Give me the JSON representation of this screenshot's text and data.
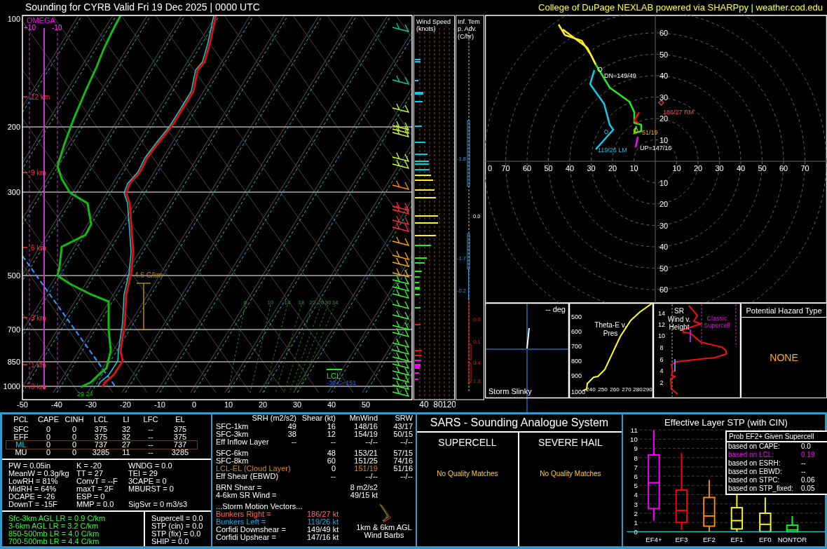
{
  "header": {
    "title": "Sounding for CYRB Valid  Fri 19 Dec 2025 | 0000 UTC",
    "credit": "College of DuPage NEXLAB powered via SHARPpy | weather.cod.edu"
  },
  "skewt": {
    "pressure_labels": [
      "100",
      "200",
      "300",
      "500",
      "700",
      "850",
      "1000"
    ],
    "temperature_labels": [
      "-50",
      "-40",
      "-30",
      "-20",
      "-10",
      "0",
      "10",
      "20",
      "30",
      "40",
      "50"
    ],
    "height_labels": [
      "12 km",
      "9 km",
      "6 km",
      "3 km",
      "1 km",
      "0 km"
    ],
    "omega": {
      "title": "OMEGA",
      "ticks": [
        "+10",
        "-10"
      ]
    },
    "lapse_rate": "4.6 C/km",
    "lcl": "LCL",
    "isotherm_height": "-30 C=151",
    "surface_values": "29 24",
    "mixing_ratio_labels": [
      "6",
      "10",
      "14",
      "18",
      "22",
      "26",
      "30",
      "34"
    ]
  },
  "wind_speed": {
    "title": "Wind Speed (knots)",
    "ticks": [
      "40",
      "80",
      "120"
    ]
  },
  "temp_advection": {
    "title": "Inf. Temp. Adv. (C/hr)",
    "values": [
      {
        "text": "-1.8",
        "kind": "cold"
      },
      {
        "text": "0.0",
        "kind": "neutral"
      },
      {
        "text": "-1.7",
        "kind": "cold"
      },
      {
        "text": "-0.2",
        "kind": "cold"
      },
      {
        "text": "0.0",
        "kind": "warm"
      },
      {
        "text": "0.1",
        "kind": "warm"
      },
      {
        "text": "0.4",
        "kind": "warm"
      },
      {
        "text": "1.3",
        "kind": "warm"
      }
    ]
  },
  "hodograph": {
    "x_labels": [
      "0",
      "70",
      "60",
      "50",
      "40",
      "30",
      "20",
      "10",
      "10",
      "20",
      "30",
      "40",
      "50",
      "60",
      "70"
    ],
    "y_labels": [
      "60",
      "50",
      "40",
      "30",
      "20",
      "10",
      "10",
      "20",
      "30",
      "40",
      "50",
      "60"
    ],
    "annotations": [
      {
        "text": "DN=149/49",
        "kind": "downshear"
      },
      {
        "text": "186/27 RM",
        "kind": "right_mover"
      },
      {
        "text": "51/19",
        "kind": "mean_wind"
      },
      {
        "text": "UP=147/16",
        "kind": "upshear"
      },
      {
        "text": "119/26 LM",
        "kind": "left_mover"
      }
    ]
  },
  "storm_slinky": {
    "direction": "-- deg",
    "label": "Storm Slinky"
  },
  "theta_e": {
    "title": "Theta-E v. Pres",
    "y_ticks": [
      "500",
      "600",
      "700",
      "800",
      "900",
      "1000"
    ],
    "x_ticks": [
      "240",
      "250",
      "260",
      "270",
      "280",
      "290"
    ]
  },
  "sr_wind": {
    "title": "SR Wind v. Height",
    "y_ticks": [
      "14",
      "12",
      "10",
      "8",
      "6",
      "4",
      "2"
    ],
    "zone": "Classic Supercell"
  },
  "hazard": {
    "title": "Potential Hazard Type",
    "value": "NONE"
  },
  "thermo": {
    "columns": [
      "PCL",
      "CAPE",
      "CINH",
      "LCL",
      "LI",
      "LFC",
      "EL"
    ],
    "rows": [
      {
        "cells": [
          "SFC",
          "0",
          "0",
          "375",
          "32",
          "--",
          "375"
        ],
        "selected": false
      },
      {
        "cells": [
          "EFF",
          "0",
          "0",
          "375",
          "32",
          "--",
          "375"
        ],
        "selected": false
      },
      {
        "cells": [
          "ML",
          "0",
          "0",
          "737",
          "27",
          "--",
          "737"
        ],
        "selected": true
      },
      {
        "cells": [
          "MU",
          "0",
          "0",
          "3285",
          "11",
          "--",
          "3285"
        ],
        "selected": false
      }
    ],
    "indices": [
      [
        "PW = 0.05in",
        "MeanW = 0.3g/kg",
        "LowRH = 81%",
        "MidRH = 64%",
        "DCAPE = -26",
        "DownT = -15F"
      ],
      [
        "K = -20",
        "TT = 27",
        "ConvT = --F",
        "maxT = 2F",
        "ESP = 0",
        "MMP = 0.0"
      ],
      [
        "WNDG = 0.0",
        "TEI = 29",
        "3CAPE = 0",
        "MBURST = 0",
        "SigSvr = 0 m3/s3"
      ]
    ],
    "lapse_rates": [
      "Sfc-3km AGL LR = 0.9 C/km",
      "3-6km AGL LR = 3.2 C/km",
      "850-500mb LR = 4.0 C/km",
      "700-500mb LR = 4.4 C/km"
    ],
    "composites": [
      "Supercell = 0.0",
      "STP (cin) = 0.0",
      "STP (fix) = 0.0",
      "SHIP = 0.0"
    ]
  },
  "kinematics": {
    "columns": [
      "SRH (m2/s2)",
      "Shear (kt)",
      "MnWind",
      "SRW"
    ],
    "groups": [
      [
        {
          "label": "SFC-1km",
          "srh": "49",
          "shear": "16",
          "mean_wind": "148/16",
          "srw": "43/17",
          "kind": "plain"
        },
        {
          "label": "SFC-3km",
          "srh": "38",
          "shear": "12",
          "mean_wind": "154/19",
          "srw": "50/15",
          "kind": "plain"
        },
        {
          "label": "Eff Inflow Layer",
          "srh": "--",
          "shear": "--",
          "mean_wind": "--/--",
          "srw": "--/--",
          "kind": "plain"
        }
      ],
      [
        {
          "label": "SFC-6km",
          "shear": "48",
          "mean_wind": "153/21",
          "srw": "57/15",
          "kind": "plain"
        },
        {
          "label": "SFC-8km",
          "shear": "60",
          "mean_wind": "151/25",
          "srw": "74/16",
          "kind": "plain"
        },
        {
          "label": "LCL-EL (Cloud Layer)",
          "shear": "0",
          "mean_wind": "151/19",
          "srw": "51/16",
          "kind": "cloud"
        },
        {
          "label": "Eff Shear (EBWD)",
          "shear": "--",
          "mean_wind": "--/--",
          "srw": "--/--",
          "kind": "plain"
        }
      ]
    ],
    "parameters": [
      {
        "label": "BRN Shear =",
        "value": "8 m2/s2"
      },
      {
        "label": "4-6km SR Wind =",
        "value": "49/15 kt"
      }
    ],
    "storm_motion": {
      "title": "...Storm Motion Vectors...",
      "rows": [
        {
          "label": "Bunkers Right =",
          "value": "186/27 kt",
          "kind": "right"
        },
        {
          "label": "Bunkers Left =",
          "value": "119/26 kt",
          "kind": "left"
        },
        {
          "label": "Corfidi Downshear =",
          "value": "149/49 kt",
          "kind": "plain"
        },
        {
          "label": "Corfidi Upshear =",
          "value": "147/16 kt",
          "kind": "plain"
        }
      ]
    },
    "barb_caption": "1km & 6km AGL Wind Barbs"
  },
  "sars": {
    "title": "SARS - Sounding Analogue System",
    "panels": [
      {
        "title": "SUPERCELL",
        "message": "No Quality Matches"
      },
      {
        "title": "SEVERE HAIL",
        "message": "No Quality Matches"
      }
    ]
  },
  "stp": {
    "title": "Effective Layer STP (with CIN)",
    "y_ticks": [
      "11",
      "10",
      "9",
      "8",
      "7",
      "6",
      "5",
      "4",
      "3",
      "2",
      "1",
      "0"
    ],
    "categories": [
      {
        "label": "EF4+",
        "color": "#ff00ff"
      },
      {
        "label": "EF3",
        "color": "#ff0000"
      },
      {
        "label": "EF2",
        "color": "#ff8c00"
      },
      {
        "label": "EF1",
        "color": "#ffff00"
      },
      {
        "label": "EF0",
        "color": "#ffff00"
      },
      {
        "label": "NONTOR",
        "color": "#00ff00"
      }
    ],
    "prob": {
      "title": "Prob EF2+ Given Supercell",
      "rows": [
        {
          "label": "based on CAPE:",
          "value": "0.0",
          "selected": false
        },
        {
          "label": "based on LCL:",
          "value": "0.19",
          "selected": true
        },
        {
          "label": "based on ESRH:",
          "value": "--",
          "selected": false
        },
        {
          "label": "based on EBWD:",
          "value": "--",
          "selected": false
        },
        {
          "label": "based on STPC:",
          "value": "0.06",
          "selected": false
        },
        {
          "label": "based on STP_fixed:",
          "value": "0.05",
          "selected": false
        }
      ]
    }
  }
}
